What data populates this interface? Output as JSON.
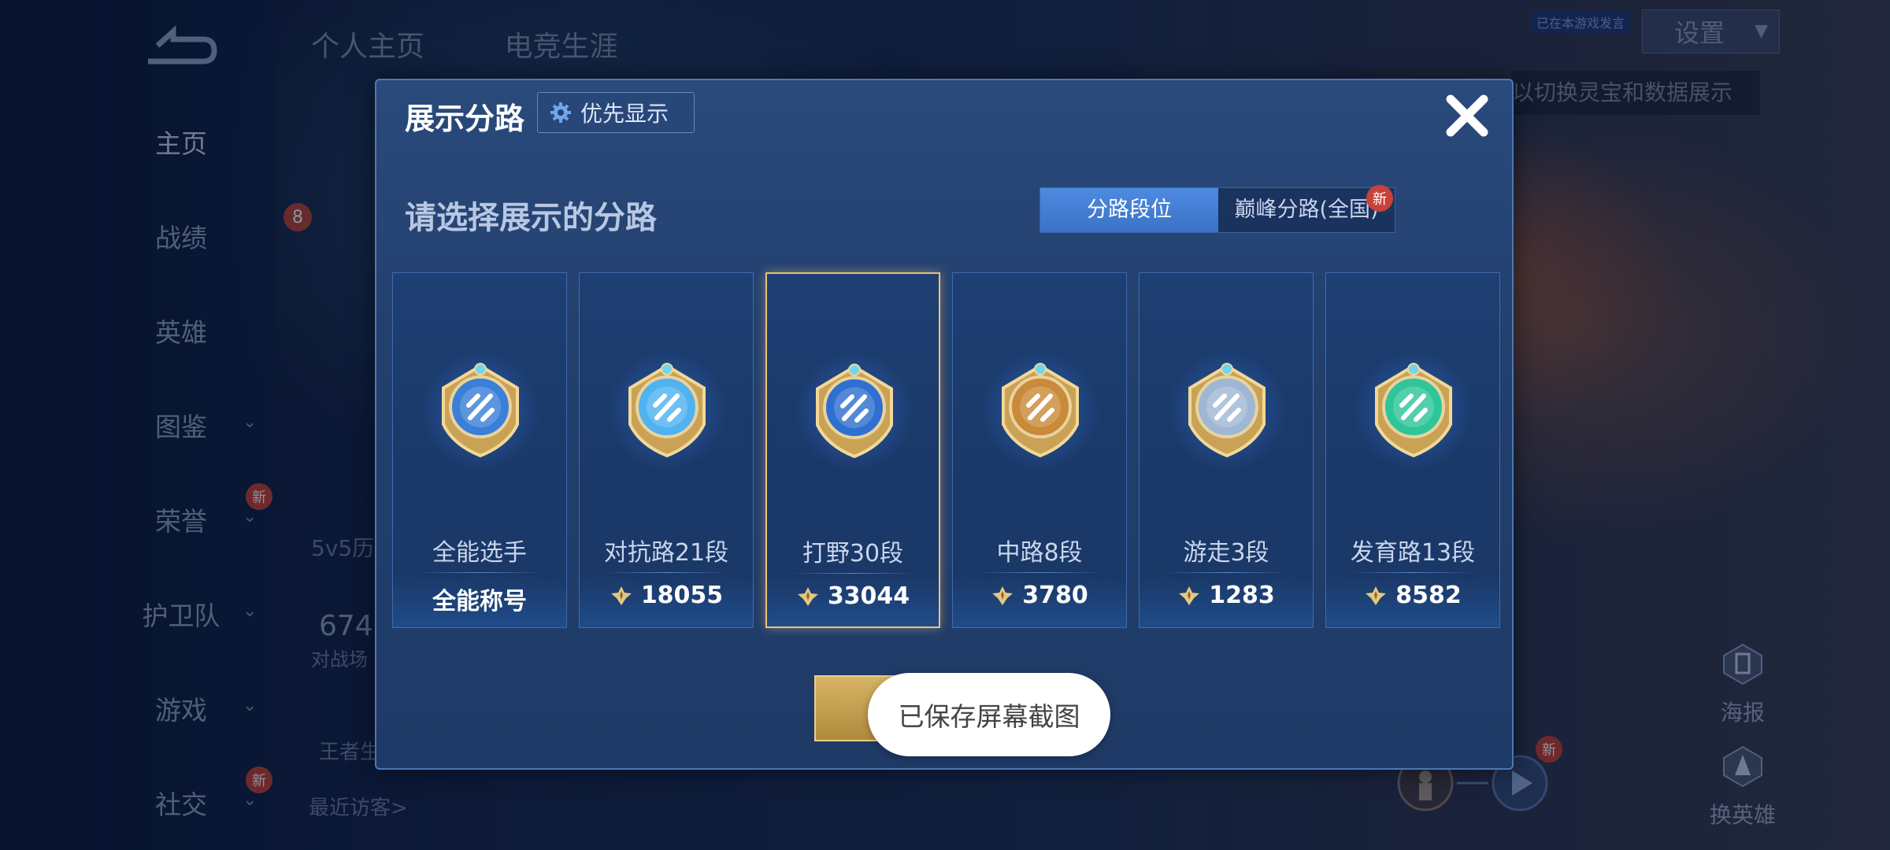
{
  "nav": {
    "items": [
      {
        "label": "主页",
        "active": true,
        "chevron": false,
        "new": false
      },
      {
        "label": "战绩",
        "active": false,
        "chevron": false,
        "new": false
      },
      {
        "label": "英雄",
        "active": false,
        "chevron": false,
        "new": false
      },
      {
        "label": "图鉴",
        "active": false,
        "chevron": true,
        "new": false
      },
      {
        "label": "荣誉",
        "active": false,
        "chevron": true,
        "new": true
      },
      {
        "label": "护卫队",
        "active": false,
        "chevron": true,
        "new": false
      },
      {
        "label": "游戏",
        "active": false,
        "chevron": true,
        "new": false
      },
      {
        "label": "社交",
        "active": false,
        "chevron": true,
        "new": true
      }
    ],
    "new_badge": "新"
  },
  "top_tabs": [
    "个人主页",
    "电竞生涯"
  ],
  "background": {
    "level_badge": "8",
    "history_label": "5v5历",
    "stat_number": "674",
    "stat_caption": "对战场",
    "king_label": "王者生",
    "recent_visitors": "最近访客>",
    "settings_label": "设置",
    "notice_chip": "已在本游戏发言",
    "tip_text": "以切换灵宝和数据展示",
    "poster_label": "海报",
    "change_hero_label": "换英雄",
    "new_badge": "新"
  },
  "modal": {
    "title": "展示分路",
    "priority_button": "优先显示",
    "prompt": "请选择展示的分路",
    "segments": [
      "分路段位",
      "巅峰分路(全国)"
    ],
    "segment_new_badge": "新",
    "lanes": [
      {
        "name": "全能选手",
        "score": "全能称号",
        "has_trophy": false,
        "selected": false,
        "emblem": "all-round-emblem-icon",
        "color": "#3a7fd8"
      },
      {
        "name": "对抗路21段",
        "score": "18055",
        "has_trophy": true,
        "selected": false,
        "emblem": "clash-lane-emblem-icon",
        "color": "#4fb3f0"
      },
      {
        "name": "打野30段",
        "score": "33044",
        "has_trophy": true,
        "selected": true,
        "emblem": "jungle-emblem-icon",
        "color": "#2f6fd0"
      },
      {
        "name": "中路8段",
        "score": "3780",
        "has_trophy": true,
        "selected": false,
        "emblem": "mid-lane-emblem-icon",
        "color": "#c98a3a"
      },
      {
        "name": "游走3段",
        "score": "1283",
        "has_trophy": true,
        "selected": false,
        "emblem": "roam-emblem-icon",
        "color": "#9fb7d4"
      },
      {
        "name": "发育路13段",
        "score": "8582",
        "has_trophy": true,
        "selected": false,
        "emblem": "farm-lane-emblem-icon",
        "color": "#2fc59a"
      }
    ]
  },
  "toast": "已保存屏幕截图",
  "colors": {
    "modal_bg": "#223f6d",
    "selected_border": "#e9c27a",
    "segment_active": "#3b72c8",
    "gold": "#d8b466"
  }
}
